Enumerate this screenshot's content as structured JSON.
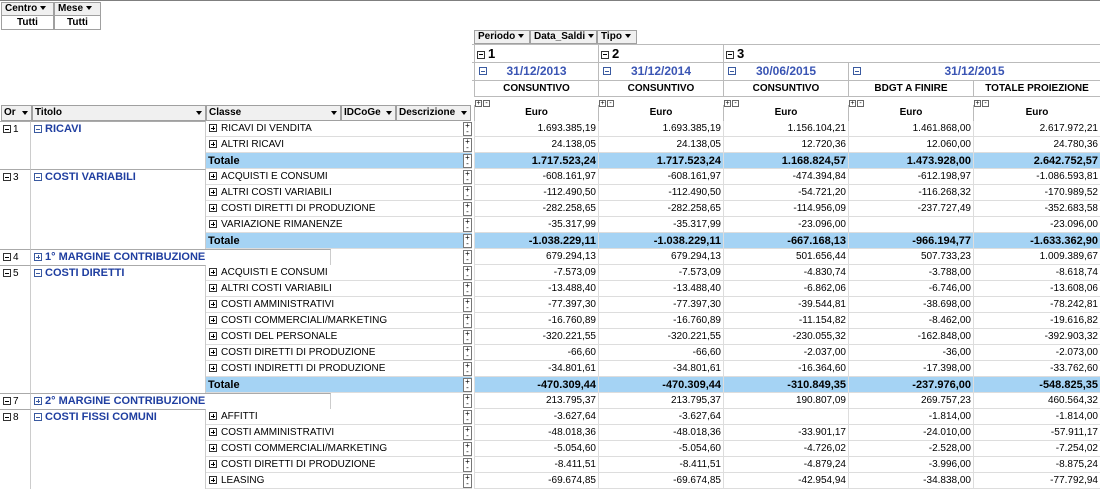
{
  "filters": [
    {
      "label": "Centro",
      "value": "Tutti"
    },
    {
      "label": "Mese",
      "value": "Tutti"
    }
  ],
  "column_fields": [
    "Periodo",
    "Data_Saldi",
    "Tipo"
  ],
  "periods": [
    {
      "label": "1"
    },
    {
      "label": "2"
    },
    {
      "label": "3"
    }
  ],
  "dates": [
    "31/12/2013",
    "31/12/2014",
    "30/06/2015",
    "31/12/2015"
  ],
  "tipos": [
    "CONSUNTIVO",
    "CONSUNTIVO",
    "CONSUNTIVO",
    "BDGT A FINIRE",
    "TOTALE PROIEZIONE"
  ],
  "unit": "Euro",
  "row_fields": [
    "Or",
    "Titolo",
    "Classe",
    "IDCoGe",
    "Descrizione"
  ],
  "mini_signs": [
    "+",
    "-"
  ],
  "total_label": "Totale",
  "groups": [
    {
      "ord": "1",
      "title": "RICAVI",
      "expanded": true,
      "rows": [
        {
          "classe": "RICAVI DI VENDITA",
          "v": [
            "1.693.385,19",
            "1.693.385,19",
            "1.156.104,21",
            "1.461.868,00",
            "2.617.972,21"
          ]
        },
        {
          "classe": "ALTRI RICAVI",
          "v": [
            "24.138,05",
            "24.138,05",
            "12.720,36",
            "12.060,00",
            "24.780,36"
          ]
        }
      ],
      "total": [
        "1.717.523,24",
        "1.717.523,24",
        "1.168.824,57",
        "1.473.928,00",
        "2.642.752,57"
      ]
    },
    {
      "ord": "3",
      "title": "COSTI VARIABILI",
      "expanded": true,
      "rows": [
        {
          "classe": "ACQUISTI E CONSUMI",
          "v": [
            "-608.161,97",
            "-608.161,97",
            "-474.394,84",
            "-612.198,97",
            "-1.086.593,81"
          ]
        },
        {
          "classe": "ALTRI COSTI VARIABILI",
          "v": [
            "-112.490,50",
            "-112.490,50",
            "-54.721,20",
            "-116.268,32",
            "-170.989,52"
          ]
        },
        {
          "classe": "COSTI DIRETTI DI PRODUZIONE",
          "v": [
            "-282.258,65",
            "-282.258,65",
            "-114.956,09",
            "-237.727,49",
            "-352.683,58"
          ]
        },
        {
          "classe": "VARIAZIONE RIMANENZE",
          "v": [
            "-35.317,99",
            "-35.317,99",
            "-23.096,00",
            "",
            "-23.096,00"
          ]
        }
      ],
      "total": [
        "-1.038.229,11",
        "-1.038.229,11",
        "-667.168,13",
        "-966.194,77",
        "-1.633.362,90"
      ]
    },
    {
      "ord": "4",
      "title": "1° MARGINE CONTRIBUZIONE",
      "expanded": false,
      "values": [
        "679.294,13",
        "679.294,13",
        "501.656,44",
        "507.733,23",
        "1.009.389,67"
      ]
    },
    {
      "ord": "5",
      "title": "COSTI DIRETTI",
      "expanded": true,
      "rows": [
        {
          "classe": "ACQUISTI E CONSUMI",
          "v": [
            "-7.573,09",
            "-7.573,09",
            "-4.830,74",
            "-3.788,00",
            "-8.618,74"
          ]
        },
        {
          "classe": "ALTRI COSTI VARIABILI",
          "v": [
            "-13.488,40",
            "-13.488,40",
            "-6.862,06",
            "-6.746,00",
            "-13.608,06"
          ]
        },
        {
          "classe": "COSTI AMMINISTRATIVI",
          "v": [
            "-77.397,30",
            "-77.397,30",
            "-39.544,81",
            "-38.698,00",
            "-78.242,81"
          ]
        },
        {
          "classe": "COSTI COMMERCIALI/MARKETING",
          "v": [
            "-16.760,89",
            "-16.760,89",
            "-11.154,82",
            "-8.462,00",
            "-19.616,82"
          ]
        },
        {
          "classe": "COSTI DEL PERSONALE",
          "v": [
            "-320.221,55",
            "-320.221,55",
            "-230.055,32",
            "-162.848,00",
            "-392.903,32"
          ]
        },
        {
          "classe": "COSTI DIRETTI DI PRODUZIONE",
          "v": [
            "-66,60",
            "-66,60",
            "-2.037,00",
            "-36,00",
            "-2.073,00"
          ]
        },
        {
          "classe": "COSTI INDIRETTI DI PRODUZIONE",
          "v": [
            "-34.801,61",
            "-34.801,61",
            "-16.364,60",
            "-17.398,00",
            "-33.762,60"
          ]
        }
      ],
      "total": [
        "-470.309,44",
        "-470.309,44",
        "-310.849,35",
        "-237.976,00",
        "-548.825,35"
      ]
    },
    {
      "ord": "7",
      "title": "2° MARGINE CONTRIBUZIONE",
      "expanded": false,
      "values": [
        "213.795,37",
        "213.795,37",
        "190.807,09",
        "269.757,23",
        "460.564,32"
      ]
    },
    {
      "ord": "8",
      "title": "COSTI FISSI COMUNI",
      "expanded": true,
      "rows": [
        {
          "classe": "AFFITTI",
          "v": [
            "-3.627,64",
            "-3.627,64",
            "",
            "-1.814,00",
            "-1.814,00"
          ]
        },
        {
          "classe": "COSTI AMMINISTRATIVI",
          "v": [
            "-48.018,36",
            "-48.018,36",
            "-33.901,17",
            "-24.010,00",
            "-57.911,17"
          ]
        },
        {
          "classe": "COSTI COMMERCIALI/MARKETING",
          "v": [
            "-5.054,60",
            "-5.054,60",
            "-4.726,02",
            "-2.528,00",
            "-7.254,02"
          ]
        },
        {
          "classe": "COSTI DIRETTI DI PRODUZIONE",
          "v": [
            "-8.411,51",
            "-8.411,51",
            "-4.879,24",
            "-3.996,00",
            "-8.875,24"
          ]
        },
        {
          "classe": "LEASING",
          "v": [
            "-69.674,85",
            "-69.674,85",
            "-42.954,94",
            "-34.838,00",
            "-77.792,94"
          ]
        }
      ]
    }
  ]
}
